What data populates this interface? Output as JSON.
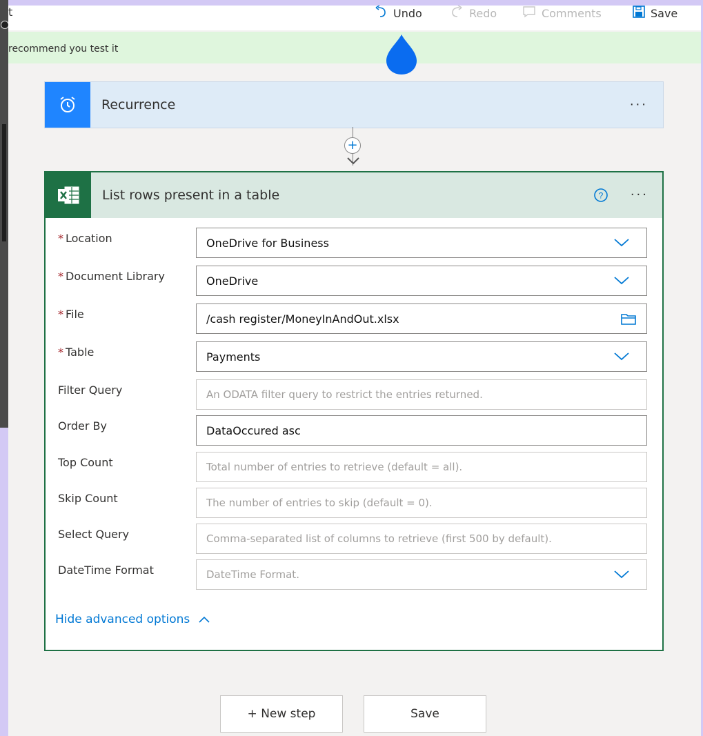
{
  "toolbar": {
    "app_name": "t",
    "undo": "Undo",
    "redo": "Redo",
    "comments": "Comments",
    "save": "Save"
  },
  "banner": {
    "text": "recommend you test it"
  },
  "recurrence": {
    "title": "Recurrence",
    "more": "···"
  },
  "action": {
    "title": "List rows present in a table",
    "more": "···",
    "fields": [
      {
        "label": "Location",
        "required": "*",
        "value": "OneDrive for Business",
        "placeholder": ""
      },
      {
        "label": "Document Library",
        "required": "*",
        "value": "OneDrive",
        "placeholder": ""
      },
      {
        "label": "File",
        "required": "*",
        "value": "/cash register/MoneyInAndOut.xlsx",
        "placeholder": ""
      },
      {
        "label": "Table",
        "required": "*",
        "value": "Payments",
        "placeholder": ""
      },
      {
        "label": "Filter Query",
        "required": "",
        "value": "",
        "placeholder": "An ODATA filter query to restrict the entries returned."
      },
      {
        "label": "Order By",
        "required": "",
        "value": "DataOccured asc",
        "placeholder": ""
      },
      {
        "label": "Top Count",
        "required": "",
        "value": "",
        "placeholder": "Total number of entries to retrieve (default = all)."
      },
      {
        "label": "Skip Count",
        "required": "",
        "value": "",
        "placeholder": "The number of entries to skip (default = 0)."
      },
      {
        "label": "Select Query",
        "required": "",
        "value": "",
        "placeholder": "Comma-separated list of columns to retrieve (first 500 by default)."
      },
      {
        "label": "DateTime Format",
        "required": "",
        "value": "",
        "placeholder": "DateTime Format."
      }
    ],
    "hide_advanced": "Hide advanced options"
  },
  "buttons": {
    "new_step": "+ New step",
    "save": "Save"
  },
  "colors": {
    "accent": "#0078d4",
    "excel": "#1e7145",
    "required": "#a4262c"
  }
}
